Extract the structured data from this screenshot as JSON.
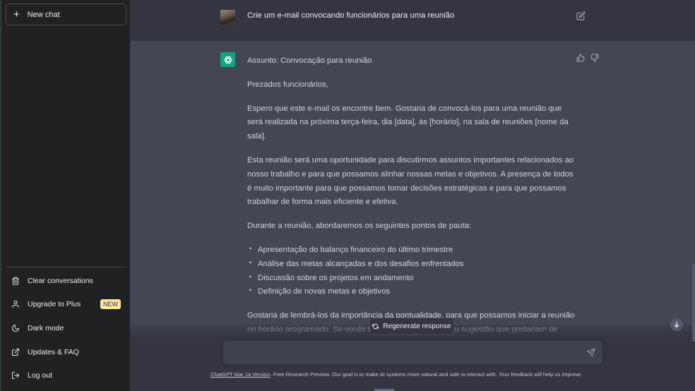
{
  "sidebar": {
    "new_chat_label": "New chat",
    "menu": [
      {
        "label": "Clear conversations",
        "icon": "trash-icon"
      },
      {
        "label": "Upgrade to Plus",
        "icon": "user-icon",
        "badge": "NEW"
      },
      {
        "label": "Dark mode",
        "icon": "moon-icon"
      },
      {
        "label": "Updates & FAQ",
        "icon": "external-link-icon"
      },
      {
        "label": "Log out",
        "icon": "logout-icon"
      }
    ]
  },
  "conversation": {
    "user_message": "Crie um e-mail convocando funcionários para uma reunião",
    "assistant": {
      "subject": "Assunto: Convocação para reunião",
      "greeting": "Prezados funcionários,",
      "paragraphs": [
        "Espero que este e-mail os encontre bem. Gostaria de convocá-los para uma reunião que será realizada na próxima terça-feira, dia [data], às [horário], na sala de reuniões [nome da sala].",
        "Esta reunião será uma oportunidade para discutirmos assuntos importantes relacionados ao nosso trabalho e para que possamos alinhar nossas metas e objetivos. A presença de todos é muito importante para que possamos tomar decisões estratégicas e para que possamos trabalhar de forma mais eficiente e efetiva.",
        "Durante a reunião, abordaremos os seguintes pontos de pauta:"
      ],
      "agenda": [
        "Apresentação do balanço financeiro do último trimestre",
        "Análise das metas alcançadas e dos desafios enfrentados",
        "Discussão sobre os projetos em andamento",
        "Definição de novas metas e objetivos"
      ],
      "closing": "Gostaria de lembrá-los da importância da pontualidade, para que possamos iniciar a reunião no horário programado. Se vocês tiverem alguma dúvida ou sugestão que gostariam de adicionar à"
    }
  },
  "composer": {
    "regenerate_label": "Regenerate response",
    "input_value": "",
    "input_placeholder": ""
  },
  "footer": {
    "link_text": "ChatGPT Mar 14 Version",
    "text": ". Free Research Preview. Our goal is to make AI systems more natural and safe to interact with. Your feedback will help us improve."
  },
  "colors": {
    "sidebar_bg": "#202123",
    "main_bg": "#343541",
    "assistant_bg": "#444654",
    "accent": "#10a37f",
    "badge_bg": "#fae69e"
  }
}
